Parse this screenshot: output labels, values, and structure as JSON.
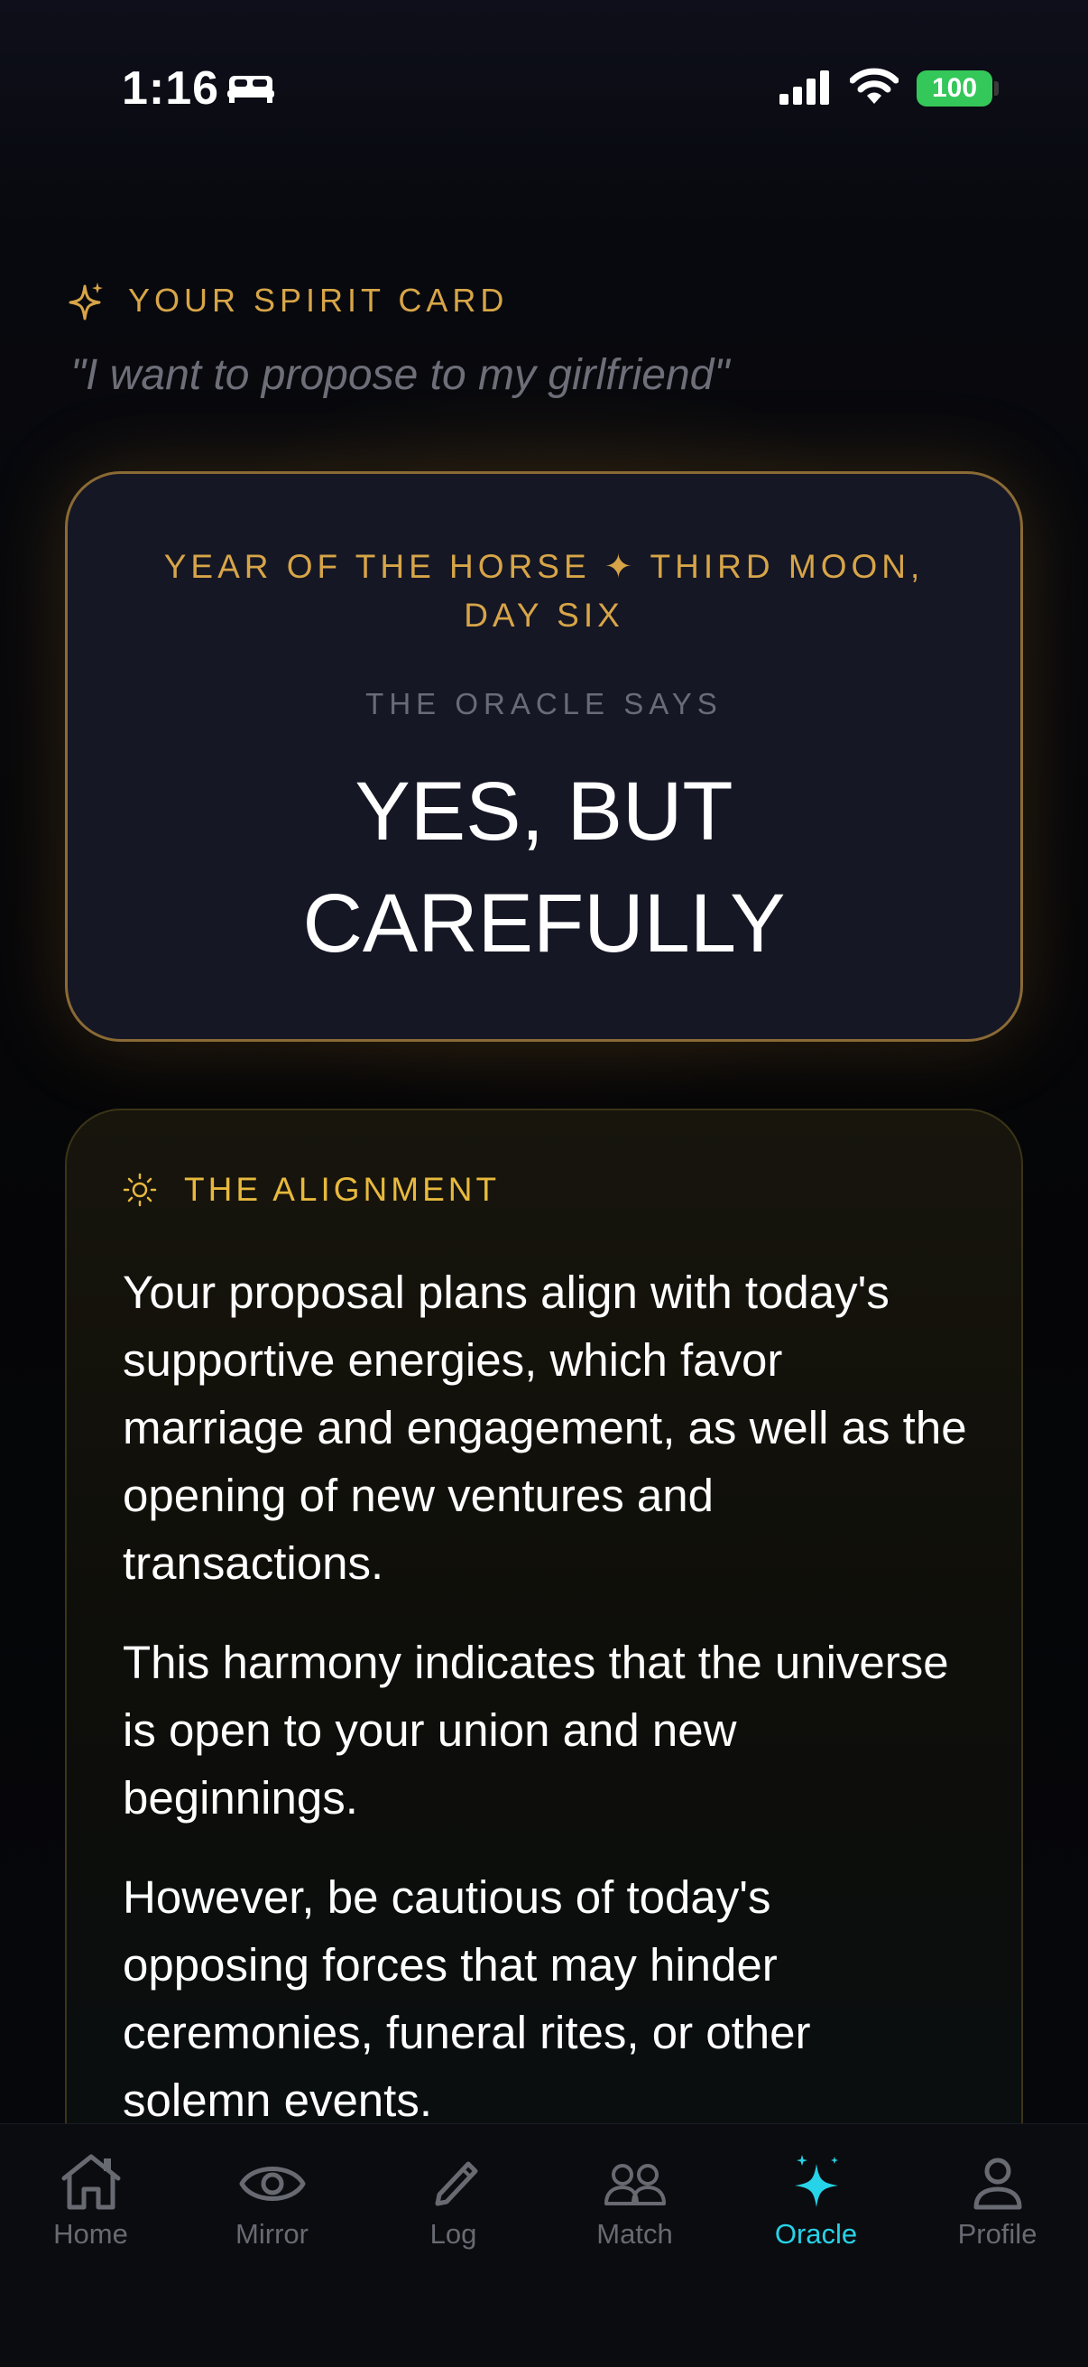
{
  "status_bar": {
    "time": "1:16",
    "battery": "100"
  },
  "header": {
    "title": "YOUR SPIRIT CARD",
    "question": "\"I want to propose to my girlfriend\""
  },
  "spirit_card": {
    "date_line1": "YEAR OF THE HORSE",
    "date_separator": "✦",
    "date_line2": "THIRD MOON,",
    "date_line3": "DAY SIX",
    "oracle_label": "THE ORACLE SAYS",
    "verdict_line1": "YES, BUT",
    "verdict_line2": "CAREFULLY"
  },
  "alignment": {
    "title": "THE ALIGNMENT",
    "paragraphs": [
      "Your proposal plans align with today's supportive energies, which favor marriage and engagement, as well as the opening of new ventures and transactions.",
      "This harmony indicates that the universe is open to your union and new beginnings.",
      "However, be cautious of today's opposing forces that may hinder ceremonies, funeral rites, or other solemn events."
    ]
  },
  "tab_bar": {
    "tabs": [
      {
        "label": "Home",
        "icon": "home-icon"
      },
      {
        "label": "Mirror",
        "icon": "eye-icon"
      },
      {
        "label": "Log",
        "icon": "pencil-icon"
      },
      {
        "label": "Match",
        "icon": "people-icon"
      },
      {
        "label": "Oracle",
        "icon": "sparkles-icon",
        "active": true
      },
      {
        "label": "Profile",
        "icon": "person-icon"
      }
    ],
    "active_color": "#27d3e8",
    "inactive_color": "#686a72"
  },
  "colors": {
    "accent_gold": "#d7a548",
    "alignment_gold": "#e8b93e",
    "battery_green": "#34c759"
  }
}
